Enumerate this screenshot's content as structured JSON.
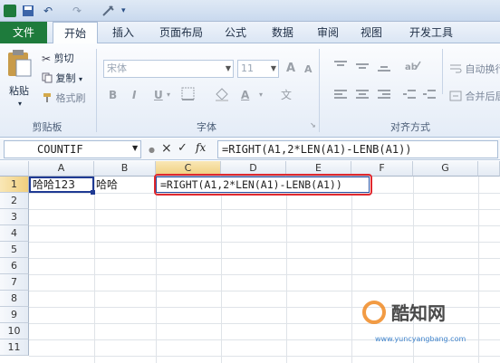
{
  "quick_access": {
    "undo": "↶",
    "redo": "↷"
  },
  "tabs": [
    "文件",
    "开始",
    "插入",
    "页面布局",
    "公式",
    "数据",
    "审阅",
    "视图",
    "开发工具"
  ],
  "ribbon": {
    "clipboard": {
      "paste": "粘贴",
      "cut": "剪切",
      "copy": "复制",
      "format_painter": "格式刷",
      "label": "剪贴板"
    },
    "font": {
      "font_name": "宋体",
      "font_size": "11",
      "bold": "B",
      "italic": "I",
      "underline": "U",
      "grow": "A",
      "shrink": "A",
      "font_color": "A",
      "label": "字体"
    },
    "alignment": {
      "wrap_text": "自动换行",
      "merge_center": "合并后居中",
      "label": "对齐方式"
    }
  },
  "formula_bar": {
    "name_box": "COUNTIF",
    "cancel": "×",
    "enter": "✓",
    "fx": "fx",
    "formula": "=RIGHT(A1,2*LEN(A1)-LENB(A1))"
  },
  "columns": [
    "A",
    "B",
    "C",
    "D",
    "E",
    "F",
    "G"
  ],
  "rows": [
    "1",
    "2",
    "3",
    "4",
    "5",
    "6",
    "7",
    "8",
    "9",
    "10",
    "11"
  ],
  "cells": {
    "A1": "哈哈123",
    "B1": "哈哈",
    "C1": "=RIGHT(A1,2*LEN(A1)-LENB(A1))"
  },
  "watermark": {
    "brand": "酷知网",
    "url": "www.yuncyangbang.com"
  },
  "colors": {
    "file_tab": "#1e7b3c",
    "edit_border": "#e0282e",
    "selection": "#1f3a93"
  }
}
